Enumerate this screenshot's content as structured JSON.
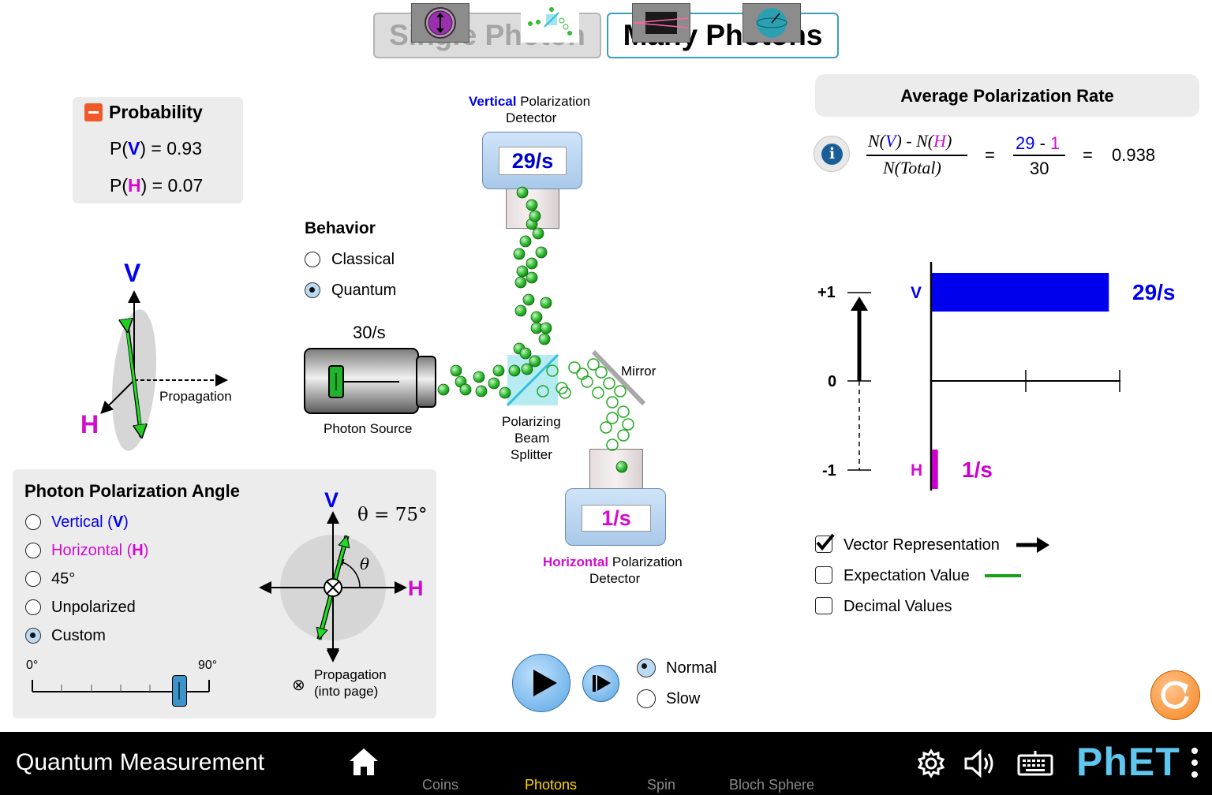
{
  "tabs": {
    "single": "Single Photon",
    "many": "Many Photons"
  },
  "probability": {
    "title": "Probability",
    "pv_prefix": "P(",
    "pv_symbol": "V",
    "pv_suffix": ") = 0.93",
    "ph_prefix": "P(",
    "ph_symbol": "H",
    "ph_suffix": ") = 0.07"
  },
  "vector_view": {
    "v": "V",
    "h": "H",
    "propagation": "Propagation"
  },
  "behavior": {
    "title": "Behavior",
    "options": [
      "Classical",
      "Quantum"
    ],
    "selected": "Quantum"
  },
  "source": {
    "rate": "30/s",
    "label": "Photon Source"
  },
  "vertical_detector": {
    "title_colored": "Vertical",
    "title_rest": " Polarization",
    "title_line2": "Detector",
    "rate": "29/s"
  },
  "horizontal_detector": {
    "title_colored": "Horizontal",
    "title_rest": " Polarization",
    "title_line2": "Detector",
    "rate": "1/s"
  },
  "mirror": "Mirror",
  "splitter": {
    "line1": "Polarizing",
    "line2": "Beam",
    "line3": "Splitter"
  },
  "polarization_angle": {
    "title": "Photon Polarization Angle",
    "options": [
      {
        "label": "Vertical (",
        "symbol": "V",
        "end": ")"
      },
      {
        "label": "Horizontal (",
        "symbol": "H",
        "end": ")"
      },
      {
        "label": "45°"
      },
      {
        "label": "Unpolarized"
      },
      {
        "label": "Custom"
      }
    ],
    "selected": "Custom",
    "slider_min": "0°",
    "slider_max": "90°",
    "slider_value_deg": 75,
    "theta_readout": "θ = 75°",
    "theta_symbol": "θ",
    "v": "V",
    "h": "H",
    "propagation_line1": "Propagation",
    "propagation_line2": "(into page)"
  },
  "avg_rate": {
    "title": "Average Polarization Rate",
    "formula_num_a": "N(",
    "formula_num_v": "V",
    "formula_num_b": ") - N(",
    "formula_num_h": "H",
    "formula_num_c": ")",
    "formula_den": "N(Total)",
    "eq1": "=",
    "num_v": "29",
    "num_minus": " - ",
    "num_h": "1",
    "den": "30",
    "eq2": "=",
    "result": "0.938"
  },
  "bar_chart": {
    "tick_plus1": "+1",
    "tick_0": "0",
    "tick_minus1": "-1",
    "v_label": "V",
    "h_label": "H",
    "v_rate": "29/s",
    "h_rate": "1/s",
    "v_count": 29,
    "h_count": 1,
    "max_count": 30
  },
  "options": {
    "vector": {
      "label": "Vector Representation",
      "checked": true
    },
    "expectation": {
      "label": "Expectation Value",
      "checked": false
    },
    "decimal": {
      "label": "Decimal Values",
      "checked": false
    }
  },
  "playback": {
    "speeds": [
      "Normal",
      "Slow"
    ],
    "selected": "Normal"
  },
  "navbar": {
    "title": "Quantum Measurement",
    "screens": [
      "Coins",
      "Photons",
      "Spin",
      "Bloch Sphere"
    ],
    "active": "Photons",
    "logo": "PhET"
  },
  "colors": {
    "v_blue": "#0000ee",
    "h_magenta": "#d20bd2",
    "photon_green": "#22aa22",
    "accent_orange": "#f5841f",
    "bar_blue": "#0000ee"
  }
}
